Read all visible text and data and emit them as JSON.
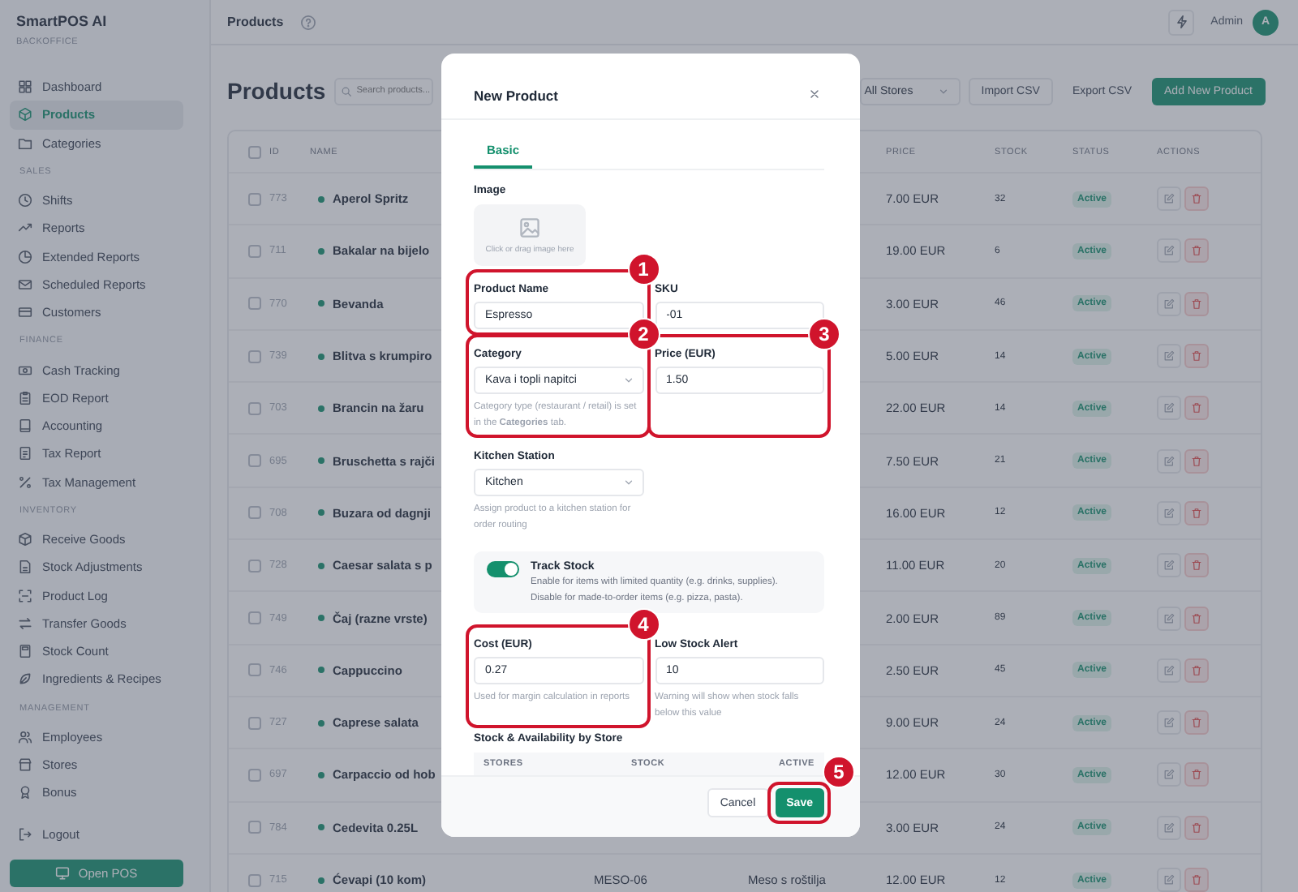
{
  "sidebar": {
    "brand": "SmartPOS AI",
    "subtitle": "BACKOFFICE",
    "sections": [
      {
        "items": [
          {
            "label": "Dashboard",
            "selected": false
          },
          {
            "label": "Products",
            "selected": true
          },
          {
            "label": "Categories",
            "selected": false
          }
        ]
      },
      {
        "heading": "SALES",
        "items": [
          {
            "label": "Shifts",
            "selected": false
          },
          {
            "label": "Reports",
            "selected": false
          },
          {
            "label": "Extended Reports",
            "selected": false
          },
          {
            "label": "Scheduled Reports",
            "selected": false
          },
          {
            "label": "Customers",
            "selected": false
          }
        ]
      },
      {
        "heading": "FINANCE",
        "items": [
          {
            "label": "Cash Tracking",
            "selected": false
          },
          {
            "label": "EOD Report",
            "selected": false
          },
          {
            "label": "Accounting",
            "selected": false
          },
          {
            "label": "Tax Report",
            "selected": false
          },
          {
            "label": "Tax Management",
            "selected": false
          }
        ]
      },
      {
        "heading": "INVENTORY",
        "items": [
          {
            "label": "Receive Goods",
            "selected": false
          },
          {
            "label": "Stock Adjustments",
            "selected": false
          },
          {
            "label": "Product Log",
            "selected": false
          },
          {
            "label": "Transfer Goods",
            "selected": false
          },
          {
            "label": "Stock Count",
            "selected": false
          },
          {
            "label": "Ingredients & Recipes",
            "selected": false
          }
        ]
      },
      {
        "heading": "MANAGEMENT",
        "items": [
          {
            "label": "Employees",
            "selected": false
          },
          {
            "label": "Stores",
            "selected": false
          },
          {
            "label": "Bonus",
            "selected": false
          }
        ]
      }
    ],
    "logout": "Logout",
    "open_pos": "Open POS"
  },
  "topbar": {
    "title": "Products",
    "user": "Admin",
    "avatar": "A"
  },
  "toolbar": {
    "title": "Products",
    "search_placeholder": "Search products...",
    "store_filter": "All Stores",
    "buttons": [
      {
        "label": "Import CSV",
        "kind": "outline"
      },
      {
        "label": "Export CSV",
        "kind": "plain"
      },
      {
        "label": "Add New Product",
        "kind": "primary"
      }
    ]
  },
  "table": {
    "select_all_checked": false,
    "columns": [
      "ID",
      "NAME",
      "PRICE",
      "STOCK",
      "STATUS",
      "ACTIONS"
    ],
    "rows": [
      {
        "checked": false,
        "id": "773",
        "name": "Aperol Spritz",
        "price": "7.00 EUR",
        "stock": "32",
        "status": "Active"
      },
      {
        "checked": false,
        "id": "711",
        "name": "Bakalar na bijelo",
        "price": "19.00 EUR",
        "stock": "6",
        "status": "Active"
      },
      {
        "checked": false,
        "id": "770",
        "name": "Bevanda",
        "price": "3.00 EUR",
        "stock": "46",
        "status": "Active"
      },
      {
        "checked": false,
        "id": "739",
        "name": "Blitva s krumpiro",
        "price": "5.00 EUR",
        "stock": "14",
        "status": "Active"
      },
      {
        "checked": false,
        "id": "703",
        "name": "Brancin na žaru",
        "price": "22.00 EUR",
        "stock": "14",
        "status": "Active"
      },
      {
        "checked": false,
        "id": "695",
        "name": "Bruschetta s rajči",
        "price": "7.50 EUR",
        "stock": "21",
        "status": "Active"
      },
      {
        "checked": false,
        "id": "708",
        "name": "Buzara od dagnji",
        "price": "16.00 EUR",
        "stock": "12",
        "status": "Active"
      },
      {
        "checked": false,
        "id": "728",
        "name": "Caesar salata s p",
        "price": "11.00 EUR",
        "stock": "20",
        "status": "Active"
      },
      {
        "checked": false,
        "id": "749",
        "name": "Čaj (razne vrste)",
        "price": "2.00 EUR",
        "stock": "89",
        "status": "Active"
      },
      {
        "checked": false,
        "id": "746",
        "name": "Cappuccino",
        "price": "2.50 EUR",
        "stock": "45",
        "status": "Active"
      },
      {
        "checked": false,
        "id": "727",
        "name": "Caprese salata",
        "price": "9.00 EUR",
        "stock": "24",
        "status": "Active"
      },
      {
        "checked": false,
        "id": "697",
        "name": "Carpaccio od hob",
        "price": "12.00 EUR",
        "stock": "30",
        "status": "Active"
      },
      {
        "checked": false,
        "id": "784",
        "name": "Cedevita 0.25L",
        "price": "3.00 EUR",
        "stock": "24",
        "status": "Active"
      },
      {
        "checked": false,
        "id": "715",
        "name": "Ćevapi (10 kom)",
        "sku": "MESO-06",
        "category": "Meso s roštilja",
        "price": "12.00 EUR",
        "stock": "12",
        "status": "Active"
      }
    ]
  },
  "modal": {
    "title": "New Product",
    "tabs": [
      {
        "label": "Basic",
        "selected": true
      }
    ],
    "image": {
      "label": "Image",
      "hint": "Click or drag image here"
    },
    "fields": [
      {
        "kind": "input",
        "label": "Product Name",
        "value": "Espresso",
        "annotation": "1"
      },
      {
        "kind": "input",
        "label": "SKU",
        "value": "-01"
      },
      {
        "kind": "select",
        "label": "Category",
        "value": "Kava i topli napitci",
        "help": "Category type (restaurant / retail) is set in the **Categories** tab.",
        "annotation": "2"
      },
      {
        "kind": "input",
        "label": "Price (EUR)",
        "value": "1.50",
        "annotation": "3"
      },
      {
        "kind": "select",
        "label": "Kitchen Station",
        "value": "Kitchen",
        "help": "Assign product to a kitchen station for order routing"
      },
      {
        "kind": "toggle",
        "label": "Track Stock",
        "on": true,
        "help": "Enable for items with limited quantity (e.g. drinks, supplies). Disable for made-to-order items (e.g. pizza, pasta)."
      },
      {
        "kind": "input",
        "label": "Cost (EUR)",
        "value": "0.27",
        "help": "Used for margin calculation in reports",
        "annotation": "4"
      },
      {
        "kind": "input",
        "label": "Low Stock Alert",
        "value": "10",
        "help": "Warning will show when stock falls below this value"
      }
    ],
    "store_table": {
      "title": "Stock & Availability by Store",
      "columns": [
        "STORES",
        "STOCK",
        "ACTIVE"
      ]
    },
    "buttons": [
      {
        "label": "Cancel",
        "kind": "secondary"
      },
      {
        "label": "Save",
        "kind": "primary",
        "annotation": "5"
      }
    ]
  }
}
